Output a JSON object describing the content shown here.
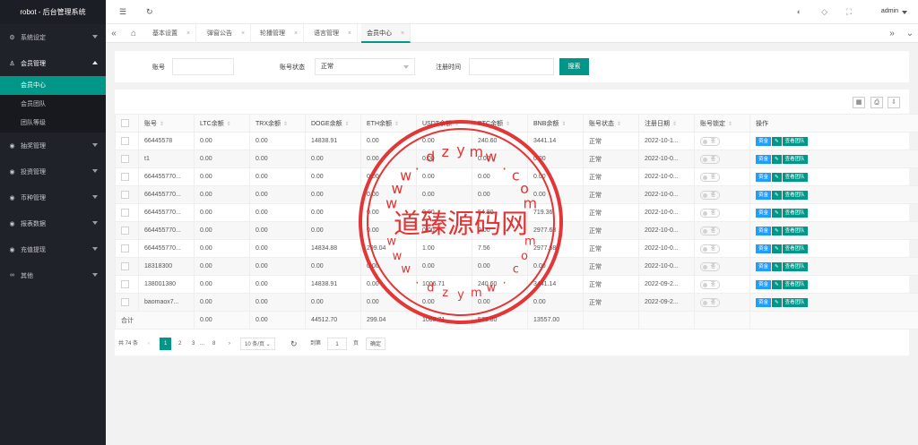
{
  "brand": "robot - 后台管理系统",
  "sidebar": {
    "items": [
      {
        "label": "系统设定",
        "icon": "gear-icon"
      },
      {
        "label": "会员管理",
        "icon": "user-icon"
      },
      {
        "label": "抽奖管理",
        "icon": "gift-icon"
      },
      {
        "label": "投资管理",
        "icon": "chart-icon"
      },
      {
        "label": "币种管理",
        "icon": "coin-icon"
      },
      {
        "label": "报表数据",
        "icon": "report-icon"
      },
      {
        "label": "充值提现",
        "icon": "wallet-icon"
      },
      {
        "label": "其他",
        "icon": "link-icon"
      }
    ],
    "sub_items": [
      "会员中心",
      "会员团队",
      "团队等级"
    ]
  },
  "topbar": {
    "user": "admin"
  },
  "tabs": [
    "基本设置",
    "弹窗公告",
    "轮播管理",
    "语言管理",
    "会员中心"
  ],
  "search": {
    "account_label": "账号",
    "account_value": "",
    "status_label": "账号状态",
    "status_value": "正常",
    "date_label": "注册时间",
    "date_value": "",
    "button": "搜索"
  },
  "table": {
    "headers": [
      "账号",
      "LTC余额",
      "TRX余额",
      "DOGE余额",
      "ETH余额",
      "USDT余额",
      "BTC余额",
      "BNB余额",
      "账号状态",
      "注册日期",
      "账号锁定",
      "操作"
    ],
    "toggle_label": "否",
    "actions": [
      "资金",
      "✎",
      "查看团队"
    ],
    "rows": [
      [
        "66445578",
        "0.00",
        "0.00",
        "14838.91",
        "0.00",
        "0.00",
        "240.60",
        "3441.14",
        "正常",
        "2022-10-1..."
      ],
      [
        "t1",
        "0.00",
        "0.00",
        "0.00",
        "0.00",
        "0.00",
        "0.00",
        "0.00",
        "正常",
        "2022-10-0..."
      ],
      [
        "664455770...",
        "0.00",
        "0.00",
        "0.00",
        "0.00",
        "0.00",
        "0.00",
        "0.00",
        "正常",
        "2022-10-0..."
      ],
      [
        "664455770...",
        "0.00",
        "0.00",
        "0.00",
        "0.00",
        "0.00",
        "0.00",
        "0.00",
        "正常",
        "2022-10-0..."
      ],
      [
        "664455770...",
        "0.00",
        "0.00",
        "0.00",
        "0.00",
        "0.00",
        "54.80",
        "719.36",
        "正常",
        "2022-10-0..."
      ],
      [
        "664455770...",
        "0.00",
        "0.00",
        "0.00",
        "0.00",
        "0.00",
        "0.00",
        "2977.68",
        "正常",
        "2022-10-0..."
      ],
      [
        "664455770...",
        "0.00",
        "0.00",
        "14834.88",
        "299.04",
        "1.00",
        "7.56",
        "2977.68",
        "正常",
        "2022-10-0..."
      ],
      [
        "18318300",
        "0.00",
        "0.00",
        "0.00",
        "0.00",
        "0.00",
        "0.00",
        "0.00",
        "正常",
        "2022-10-0..."
      ],
      [
        "138001380",
        "0.00",
        "0.00",
        "14838.91",
        "0.00",
        "1006.71",
        "240.60",
        "3441.14",
        "正常",
        "2022-09-2..."
      ],
      [
        "baomaox7...",
        "0.00",
        "0.00",
        "0.00",
        "0.00",
        "0.00",
        "0.00",
        "0.00",
        "正常",
        "2022-09-2..."
      ]
    ],
    "total": [
      "合计",
      "0.00",
      "0.00",
      "44512.70",
      "299.04",
      "1008.71",
      "573.80",
      "13557.00"
    ]
  },
  "pager": {
    "total": "共 74 条",
    "pages": [
      "1",
      "2",
      "3",
      "...",
      "8"
    ],
    "page_size": "10 条/页",
    "goto_label": "到第",
    "goto_value": "1",
    "page_unit": "页",
    "confirm": "确定"
  },
  "watermark": {
    "center": "道臻源码网",
    "upper_chars": [
      "w",
      "w",
      "w",
      ".",
      "d",
      "z",
      "y",
      "m",
      "w",
      ".",
      "c",
      "o",
      "m"
    ],
    "lower_chars": [
      "w",
      "w",
      "w",
      ".",
      "d",
      "z",
      "y",
      "m",
      "w",
      ".",
      "c",
      "o",
      "m"
    ],
    "color": "#e02020"
  }
}
